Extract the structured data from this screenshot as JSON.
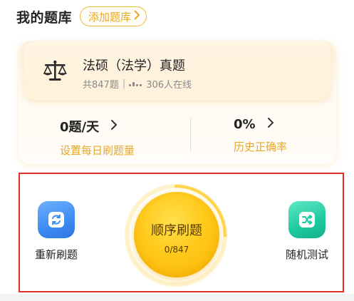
{
  "header": {
    "title": "我的题库",
    "add_button_label": "添加题库",
    "add_button_icon": "chevron-right-icon"
  },
  "bank": {
    "icon": "scale-of-justice-icon",
    "title": "法硕（法学）真题",
    "question_count": "共847题",
    "online_count": "306人在线"
  },
  "stats": [
    {
      "value": "0题/天",
      "label": "设置每日刷题量"
    },
    {
      "value": "0%",
      "label": "历史正确率"
    }
  ],
  "practice": {
    "reset_label": "重新刷题",
    "sequential_label": "顺序刷题",
    "progress_text": "0/847",
    "progress": {
      "done": 0,
      "total": 847
    },
    "random_label": "随机测试"
  },
  "colors": {
    "accent": "#e9a828",
    "highlight_border": "#e0312b",
    "reset_icon": "#3d8bf2",
    "random_icon": "#1ec9a0",
    "sequential_button": "#ffc91a"
  }
}
